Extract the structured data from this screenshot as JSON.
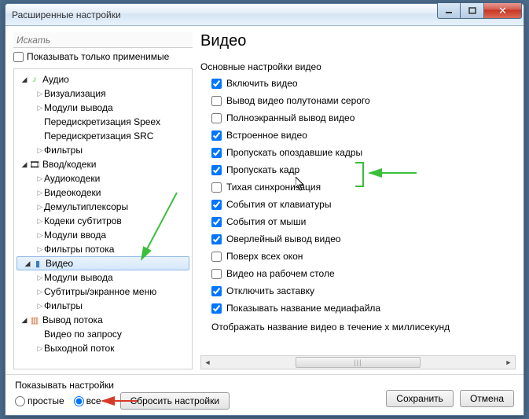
{
  "window": {
    "title": "Расширенные настройки"
  },
  "search": {
    "placeholder": "Искать"
  },
  "applicable": {
    "label": "Показывать только применимые"
  },
  "tree": {
    "audio": {
      "label": "Аудио",
      "children": [
        "Визуализация",
        "Модули вывода",
        "Передискретизация Speex",
        "Передискретизация SRC",
        "Фильтры"
      ]
    },
    "input": {
      "label": "Ввод/кодеки",
      "children": [
        "Аудиокодеки",
        "Видеокодеки",
        "Демультиплексоры",
        "Кодеки субтитров",
        "Модули ввода",
        "Фильтры потока"
      ]
    },
    "video": {
      "label": "Видео",
      "children": [
        "Модули вывода",
        "Субтитры/экранное меню",
        "Фильтры"
      ]
    },
    "output": {
      "label": "Вывод потока",
      "children": [
        "Видео по запросу",
        "Выходной поток"
      ]
    }
  },
  "page": {
    "heading": "Видео",
    "subhead": "Основные настройки видео",
    "opts": [
      {
        "label": "Включить видео",
        "checked": true
      },
      {
        "label": "Вывод видео полутонами серого",
        "checked": false
      },
      {
        "label": "Полноэкранный вывод видео",
        "checked": false
      },
      {
        "label": "Встроенное видео",
        "checked": true
      },
      {
        "label": "Пропускать опоздавшие кадры",
        "checked": true
      },
      {
        "label": "Пропускать кадр",
        "checked": true
      },
      {
        "label": "Тихая синхронизация",
        "checked": false
      },
      {
        "label": "События от клавиатуры",
        "checked": true
      },
      {
        "label": "События от мыши",
        "checked": true
      },
      {
        "label": "Оверлейный вывод видео",
        "checked": true
      },
      {
        "label": "Поверх всех окон",
        "checked": false
      },
      {
        "label": "Видео на рабочем столе",
        "checked": false
      },
      {
        "label": "Отключить заставку",
        "checked": true
      },
      {
        "label": "Показывать название медиафайла",
        "checked": true
      }
    ],
    "caption": "Отображать название видео в течение x миллисекунд"
  },
  "footer": {
    "show": "Показывать настройки",
    "simple": "простые",
    "all": "все",
    "reset": "Сбросить настройки",
    "save": "Сохранить",
    "cancel": "Отмена"
  }
}
